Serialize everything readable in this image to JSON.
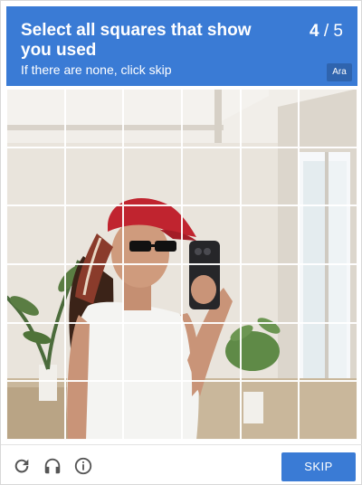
{
  "header": {
    "title": "Select all squares that show you used",
    "subtitle": "If there are none, click skip",
    "counter_current": "4",
    "counter_total": "5",
    "language_button": "Ara"
  },
  "grid": {
    "rows": 6,
    "cols": 6
  },
  "footer": {
    "icons": [
      "refresh-icon",
      "headphones-icon",
      "info-icon"
    ],
    "skip_label": "SKIP"
  },
  "colors": {
    "header_bg": "#3a7bd5",
    "button_bg": "#3a7bd5",
    "icon_color": "#555555"
  }
}
